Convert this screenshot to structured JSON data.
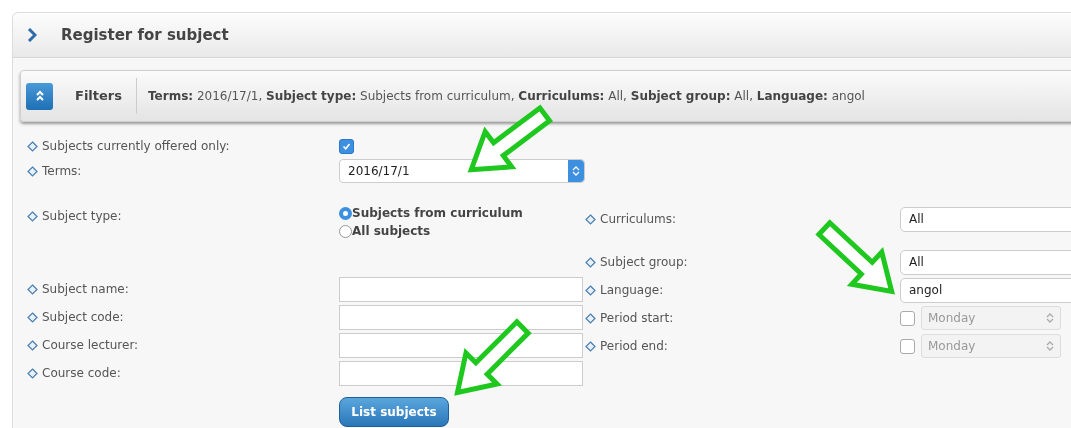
{
  "title": "Register for subject",
  "filters": {
    "label": "Filters",
    "summary": "**Terms:** 2016/17/1, **Subject type:** Subjects from curriculum, **Curriculums:** All, **Subject group:** All, **Language:** angol"
  },
  "left_fields": [
    {
      "kind": "checkbox",
      "label": "Subjects currently offered only:",
      "checked": true
    },
    {
      "kind": "select",
      "label": "Terms:",
      "value": "2016/17/1"
    },
    {
      "kind": "radio",
      "label": "Subject type:",
      "options": [
        {
          "label": "Subjects from curriculum",
          "selected": true
        },
        {
          "label": "All subjects",
          "selected": false
        }
      ]
    },
    {
      "kind": "text",
      "label": "Subject name:"
    },
    {
      "kind": "text",
      "label": "Subject code:"
    },
    {
      "kind": "text",
      "label": "Course lecturer:"
    },
    {
      "kind": "text",
      "label": "Course code:"
    }
  ],
  "right_fields": [
    {
      "kind": "text",
      "label": "Curriculums:",
      "value": "All"
    },
    {
      "kind": "text",
      "label": "Subject group:",
      "value": "All"
    },
    {
      "kind": "text",
      "label": "Language:",
      "value": "angol"
    },
    {
      "kind": "date",
      "label": "Period start:",
      "checked": false,
      "disabled": true,
      "value": "Monday"
    },
    {
      "kind": "date",
      "label": "Period end:",
      "checked": false,
      "disabled": true,
      "value": "Monday"
    }
  ],
  "button": "List subjects"
}
